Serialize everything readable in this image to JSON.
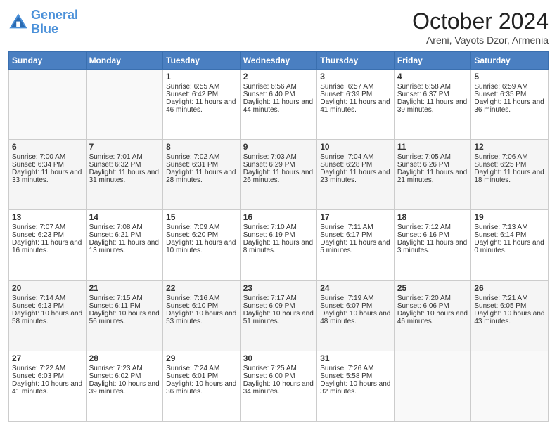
{
  "logo": {
    "line1": "General",
    "line2": "Blue"
  },
  "title": "October 2024",
  "location": "Areni, Vayots Dzor, Armenia",
  "days_of_week": [
    "Sunday",
    "Monday",
    "Tuesday",
    "Wednesday",
    "Thursday",
    "Friday",
    "Saturday"
  ],
  "weeks": [
    [
      {
        "day": "",
        "sunrise": "",
        "sunset": "",
        "daylight": ""
      },
      {
        "day": "",
        "sunrise": "",
        "sunset": "",
        "daylight": ""
      },
      {
        "day": "1",
        "sunrise": "Sunrise: 6:55 AM",
        "sunset": "Sunset: 6:42 PM",
        "daylight": "Daylight: 11 hours and 46 minutes."
      },
      {
        "day": "2",
        "sunrise": "Sunrise: 6:56 AM",
        "sunset": "Sunset: 6:40 PM",
        "daylight": "Daylight: 11 hours and 44 minutes."
      },
      {
        "day": "3",
        "sunrise": "Sunrise: 6:57 AM",
        "sunset": "Sunset: 6:39 PM",
        "daylight": "Daylight: 11 hours and 41 minutes."
      },
      {
        "day": "4",
        "sunrise": "Sunrise: 6:58 AM",
        "sunset": "Sunset: 6:37 PM",
        "daylight": "Daylight: 11 hours and 39 minutes."
      },
      {
        "day": "5",
        "sunrise": "Sunrise: 6:59 AM",
        "sunset": "Sunset: 6:35 PM",
        "daylight": "Daylight: 11 hours and 36 minutes."
      }
    ],
    [
      {
        "day": "6",
        "sunrise": "Sunrise: 7:00 AM",
        "sunset": "Sunset: 6:34 PM",
        "daylight": "Daylight: 11 hours and 33 minutes."
      },
      {
        "day": "7",
        "sunrise": "Sunrise: 7:01 AM",
        "sunset": "Sunset: 6:32 PM",
        "daylight": "Daylight: 11 hours and 31 minutes."
      },
      {
        "day": "8",
        "sunrise": "Sunrise: 7:02 AM",
        "sunset": "Sunset: 6:31 PM",
        "daylight": "Daylight: 11 hours and 28 minutes."
      },
      {
        "day": "9",
        "sunrise": "Sunrise: 7:03 AM",
        "sunset": "Sunset: 6:29 PM",
        "daylight": "Daylight: 11 hours and 26 minutes."
      },
      {
        "day": "10",
        "sunrise": "Sunrise: 7:04 AM",
        "sunset": "Sunset: 6:28 PM",
        "daylight": "Daylight: 11 hours and 23 minutes."
      },
      {
        "day": "11",
        "sunrise": "Sunrise: 7:05 AM",
        "sunset": "Sunset: 6:26 PM",
        "daylight": "Daylight: 11 hours and 21 minutes."
      },
      {
        "day": "12",
        "sunrise": "Sunrise: 7:06 AM",
        "sunset": "Sunset: 6:25 PM",
        "daylight": "Daylight: 11 hours and 18 minutes."
      }
    ],
    [
      {
        "day": "13",
        "sunrise": "Sunrise: 7:07 AM",
        "sunset": "Sunset: 6:23 PM",
        "daylight": "Daylight: 11 hours and 16 minutes."
      },
      {
        "day": "14",
        "sunrise": "Sunrise: 7:08 AM",
        "sunset": "Sunset: 6:21 PM",
        "daylight": "Daylight: 11 hours and 13 minutes."
      },
      {
        "day": "15",
        "sunrise": "Sunrise: 7:09 AM",
        "sunset": "Sunset: 6:20 PM",
        "daylight": "Daylight: 11 hours and 10 minutes."
      },
      {
        "day": "16",
        "sunrise": "Sunrise: 7:10 AM",
        "sunset": "Sunset: 6:19 PM",
        "daylight": "Daylight: 11 hours and 8 minutes."
      },
      {
        "day": "17",
        "sunrise": "Sunrise: 7:11 AM",
        "sunset": "Sunset: 6:17 PM",
        "daylight": "Daylight: 11 hours and 5 minutes."
      },
      {
        "day": "18",
        "sunrise": "Sunrise: 7:12 AM",
        "sunset": "Sunset: 6:16 PM",
        "daylight": "Daylight: 11 hours and 3 minutes."
      },
      {
        "day": "19",
        "sunrise": "Sunrise: 7:13 AM",
        "sunset": "Sunset: 6:14 PM",
        "daylight": "Daylight: 11 hours and 0 minutes."
      }
    ],
    [
      {
        "day": "20",
        "sunrise": "Sunrise: 7:14 AM",
        "sunset": "Sunset: 6:13 PM",
        "daylight": "Daylight: 10 hours and 58 minutes."
      },
      {
        "day": "21",
        "sunrise": "Sunrise: 7:15 AM",
        "sunset": "Sunset: 6:11 PM",
        "daylight": "Daylight: 10 hours and 56 minutes."
      },
      {
        "day": "22",
        "sunrise": "Sunrise: 7:16 AM",
        "sunset": "Sunset: 6:10 PM",
        "daylight": "Daylight: 10 hours and 53 minutes."
      },
      {
        "day": "23",
        "sunrise": "Sunrise: 7:17 AM",
        "sunset": "Sunset: 6:09 PM",
        "daylight": "Daylight: 10 hours and 51 minutes."
      },
      {
        "day": "24",
        "sunrise": "Sunrise: 7:19 AM",
        "sunset": "Sunset: 6:07 PM",
        "daylight": "Daylight: 10 hours and 48 minutes."
      },
      {
        "day": "25",
        "sunrise": "Sunrise: 7:20 AM",
        "sunset": "Sunset: 6:06 PM",
        "daylight": "Daylight: 10 hours and 46 minutes."
      },
      {
        "day": "26",
        "sunrise": "Sunrise: 7:21 AM",
        "sunset": "Sunset: 6:05 PM",
        "daylight": "Daylight: 10 hours and 43 minutes."
      }
    ],
    [
      {
        "day": "27",
        "sunrise": "Sunrise: 7:22 AM",
        "sunset": "Sunset: 6:03 PM",
        "daylight": "Daylight: 10 hours and 41 minutes."
      },
      {
        "day": "28",
        "sunrise": "Sunrise: 7:23 AM",
        "sunset": "Sunset: 6:02 PM",
        "daylight": "Daylight: 10 hours and 39 minutes."
      },
      {
        "day": "29",
        "sunrise": "Sunrise: 7:24 AM",
        "sunset": "Sunset: 6:01 PM",
        "daylight": "Daylight: 10 hours and 36 minutes."
      },
      {
        "day": "30",
        "sunrise": "Sunrise: 7:25 AM",
        "sunset": "Sunset: 6:00 PM",
        "daylight": "Daylight: 10 hours and 34 minutes."
      },
      {
        "day": "31",
        "sunrise": "Sunrise: 7:26 AM",
        "sunset": "Sunset: 5:58 PM",
        "daylight": "Daylight: 10 hours and 32 minutes."
      },
      {
        "day": "",
        "sunrise": "",
        "sunset": "",
        "daylight": ""
      },
      {
        "day": "",
        "sunrise": "",
        "sunset": "",
        "daylight": ""
      }
    ]
  ]
}
